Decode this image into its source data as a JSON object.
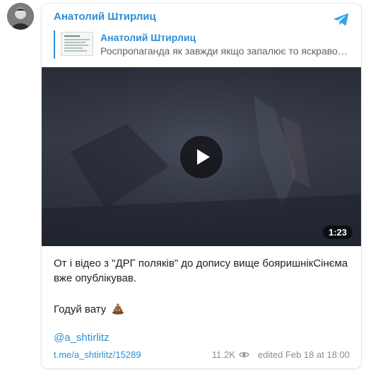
{
  "post": {
    "author": "Анатолий Штирлиц",
    "reply": {
      "author": "Анатолий Штирлиц",
      "text": "Роспропаганда як завжди якщо запалює то яскраво...."
    },
    "video": {
      "duration": "1:23"
    },
    "text_paragraph1": "От і відео з \"ДРГ поляків\" до допису вище бояришнікСінєма вже опублікував.",
    "text_paragraph2": "Годуй вату",
    "mention": "@a_shtirlitz",
    "link": "t.me/a_shtirlitz/15289",
    "views": "11.2K",
    "edited_date": "edited  Feb 18 at 18:00"
  },
  "icons": {
    "channel_icon": "telegram-icon",
    "views_icon": "eye-icon",
    "play_icon": "play-icon",
    "emoji": "pile-of-poo"
  },
  "colors": {
    "accent": "#2b8fd6",
    "text": "#1f1f1f",
    "muted": "#8a8d91"
  }
}
